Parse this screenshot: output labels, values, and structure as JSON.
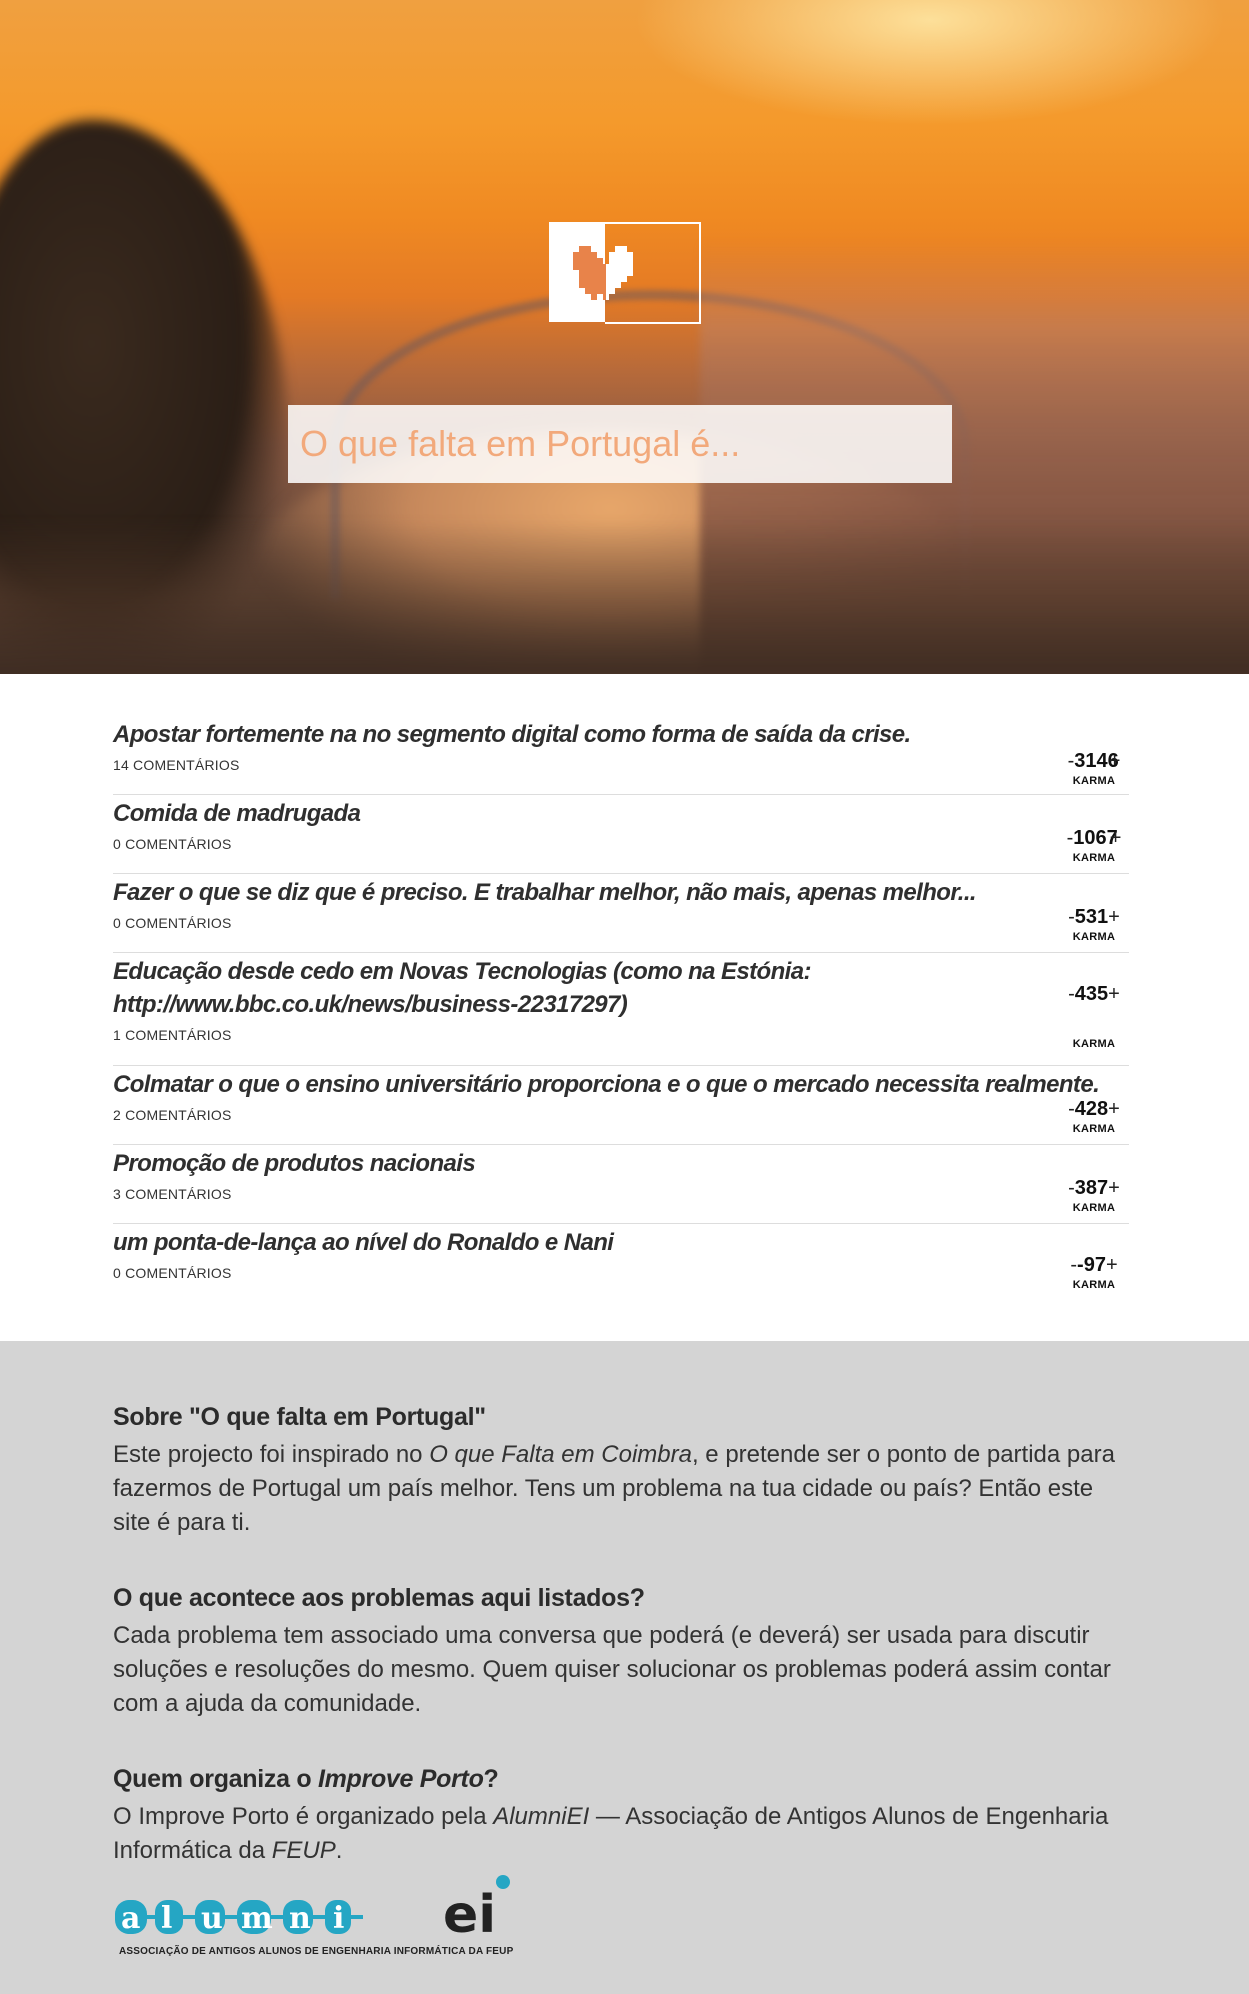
{
  "hero": {
    "logo_name": "heart-logo",
    "search_placeholder": "O que falta em Portugal é..."
  },
  "items": [
    {
      "title": "Apostar fortemente na no segmento digital como forma de saída da crise.",
      "comments": "14 COMENTÁRIOS",
      "karma": "3146",
      "karma_label": "KARMA"
    },
    {
      "title": "Comida de madrugada",
      "comments": "0 COMENTÁRIOS",
      "karma": "1067",
      "karma_label": "KARMA"
    },
    {
      "title": "Fazer o que se diz que é preciso. E trabalhar melhor, não mais, apenas melhor...",
      "comments": "0 COMENTÁRIOS",
      "karma": "531",
      "karma_label": "KARMA"
    },
    {
      "title": "Educação desde cedo em Novas Tecnologias (como na Estónia: http://www.bbc.co.uk/news/business-22317297)",
      "comments": "1 COMENTÁRIOS",
      "karma": "435",
      "karma_label": "KARMA"
    },
    {
      "title": "Colmatar o que o ensino universitário proporciona e o que o mercado necessita realmente.",
      "comments": "2 COMENTÁRIOS",
      "karma": "428",
      "karma_label": "KARMA"
    },
    {
      "title": "Promoção de produtos nacionais",
      "comments": "3 COMENTÁRIOS",
      "karma": "387",
      "karma_label": "KARMA"
    },
    {
      "title": "um ponta-de-lança ao nível do Ronaldo e Nani",
      "comments": "0 COMENTÁRIOS",
      "karma": "-97",
      "karma_label": "KARMA"
    }
  ],
  "karma_controls": {
    "minus": "-",
    "plus": "+"
  },
  "about": {
    "heading1": "Sobre \"O que falta em Portugal\"",
    "p1_a": "Este projecto foi inspirado no ",
    "p1_em": "O que Falta em Coimbra",
    "p1_b": ", e pretende ser o ponto de partida para fazermos de Portugal um país melhor. Tens um problema na tua cidade ou país? Então este site é para ti.",
    "heading2": "O que acontece aos problemas aqui listados?",
    "p2": "Cada problema tem associado uma conversa que poderá (e deverá) ser usada para discutir soluções e resoluções do mesmo. Quem quiser solucionar os problemas poderá assim contar com a ajuda da comunidade.",
    "heading3_a": "Quem organiza o ",
    "heading3_em": "Improve Porto",
    "heading3_b": "?",
    "p3_a": "O Improve Porto é organizado pela ",
    "p3_em1": "AlumniEI",
    "p3_b": " — Associação de Antigos Alunos de Engenharia Informática da ",
    "p3_em2": "FEUP",
    "p3_c": "."
  },
  "alumni_logo": {
    "letters": [
      "a",
      "l",
      "u",
      "m",
      "n",
      "i",
      "ei"
    ],
    "caption": "ASSOCIAÇÃO DE ANTIGOS ALUNOS DE ENGENHARIA INFORMÁTICA DA FEUP"
  },
  "colors": {
    "accent": "#f2a97b",
    "logo_cyan": "#25a6c4",
    "info_bg": "#d4d4d4"
  }
}
